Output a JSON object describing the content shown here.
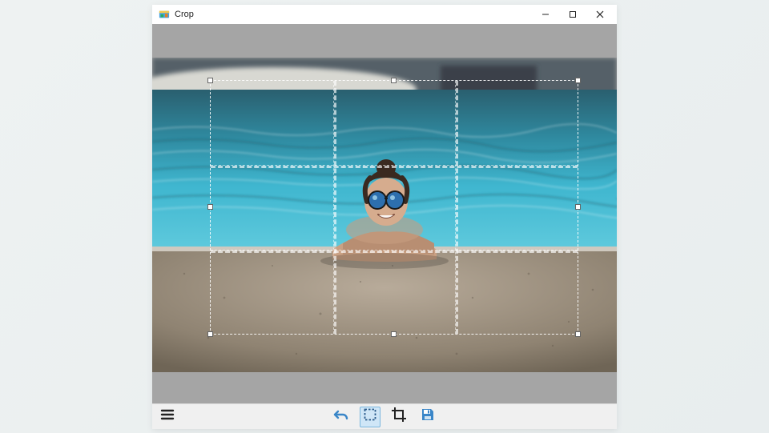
{
  "window": {
    "title": "Crop",
    "icon": "app-icon"
  },
  "window_controls": {
    "minimize": "minimize-icon",
    "maximize": "maximize-icon",
    "close": "close-icon"
  },
  "toolbar": {
    "menu": "menu-icon",
    "undo": "undo-icon",
    "select": "selection-icon",
    "crop": "crop-icon",
    "save": "save-icon",
    "selected_tool": "select"
  },
  "image": {
    "description": "Woman with sunglasses resting arms on edge of swimming pool"
  },
  "crop": {
    "grid": "rule-of-thirds"
  },
  "colors": {
    "toolbar_bg": "#f0f0f0",
    "canvas_bg": "#a5a5a5",
    "accent": "#3a86c8"
  }
}
